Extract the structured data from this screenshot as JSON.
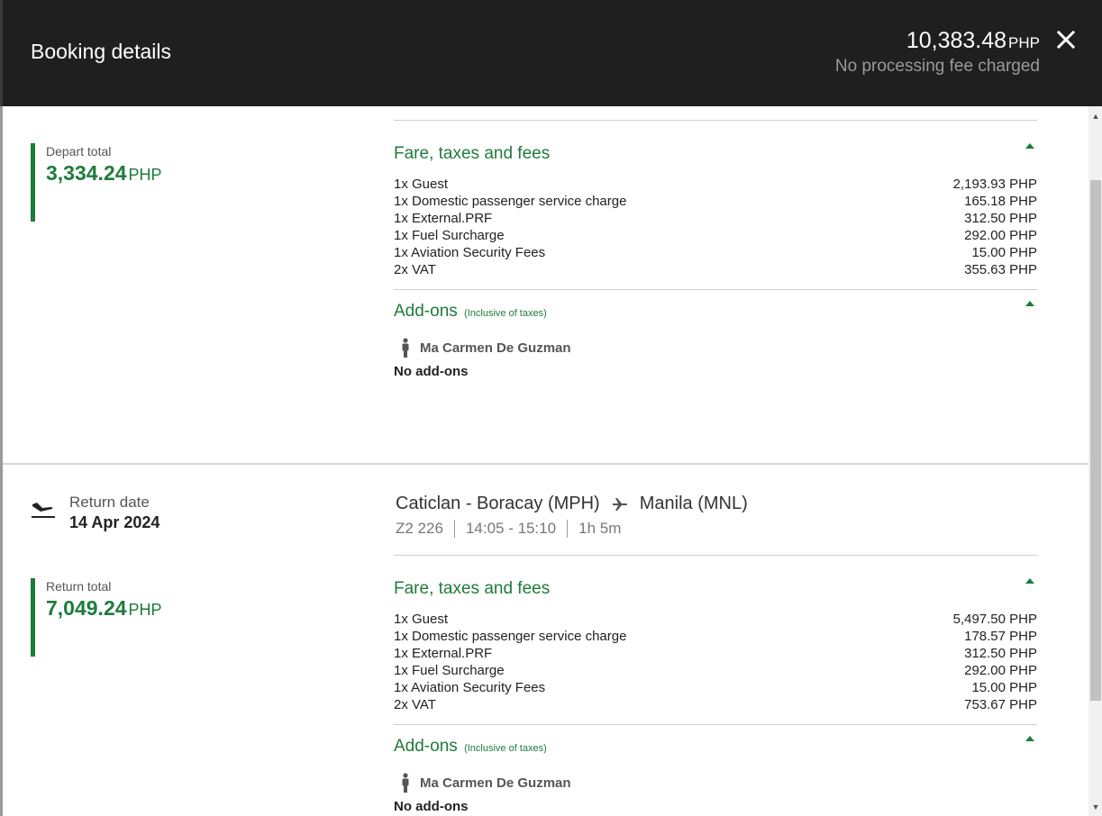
{
  "header": {
    "title": "Booking details",
    "total_amount": "10,383.48",
    "total_currency": "PHP",
    "fee_note": "No processing fee charged",
    "close_icon": "close-icon"
  },
  "depart": {
    "total_label": "Depart total",
    "total_value": "3,334.24",
    "total_currency": "PHP",
    "fares_heading": "Fare, taxes and fees",
    "fees": [
      {
        "label": "1x Guest",
        "amount": "2,193.93 PHP"
      },
      {
        "label": "1x Domestic passenger service charge",
        "amount": "165.18 PHP"
      },
      {
        "label": "1x External.PRF",
        "amount": "312.50 PHP"
      },
      {
        "label": "1x Fuel Surcharge",
        "amount": "292.00 PHP"
      },
      {
        "label": "1x Aviation Security Fees",
        "amount": "15.00 PHP"
      },
      {
        "label": "2x VAT",
        "amount": "355.63 PHP"
      }
    ],
    "addons_heading": "Add-ons",
    "addons_sub": "(Inclusive of taxes)",
    "passenger": "Ma Carmen De Guzman",
    "no_addons": "No add-ons"
  },
  "return": {
    "date_label": "Return date",
    "date": "14 Apr 2024",
    "origin": "Caticlan - Boracay (MPH)",
    "destination": "Manila (MNL)",
    "flight_no": "Z2 226",
    "time": "14:05 - 15:10",
    "duration": "1h 5m",
    "total_label": "Return total",
    "total_value": "7,049.24",
    "total_currency": "PHP",
    "fares_heading": "Fare, taxes and fees",
    "fees": [
      {
        "label": "1x Guest",
        "amount": "5,497.50 PHP"
      },
      {
        "label": "1x Domestic passenger service charge",
        "amount": "178.57 PHP"
      },
      {
        "label": "1x External.PRF",
        "amount": "312.50 PHP"
      },
      {
        "label": "1x Fuel Surcharge",
        "amount": "292.00 PHP"
      },
      {
        "label": "1x Aviation Security Fees",
        "amount": "15.00 PHP"
      },
      {
        "label": "2x VAT",
        "amount": "753.67 PHP"
      }
    ],
    "addons_heading": "Add-ons",
    "addons_sub": "(Inclusive of taxes)",
    "passenger": "Ma Carmen De Guzman",
    "no_addons": "No add-ons"
  },
  "colors": {
    "accent_green": "#1e7b3c",
    "header_bg": "#1f1f1f"
  }
}
